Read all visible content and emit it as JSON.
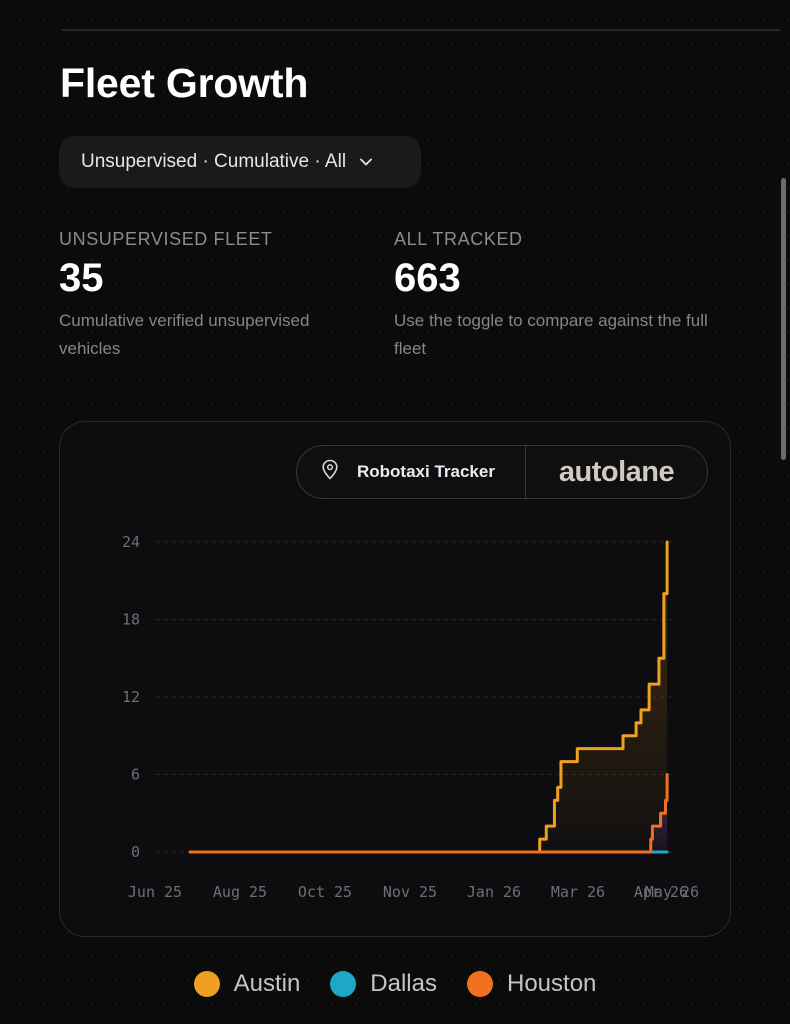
{
  "page": {
    "title": "Fleet Growth",
    "filter_label": "Unsupervised · Cumulative · All"
  },
  "stats": [
    {
      "label": "UNSUPERVISED FLEET",
      "value": "35",
      "description": "Cumulative verified unsupervised vehicles"
    },
    {
      "label": "ALL TRACKED",
      "value": "663",
      "description": "Use the toggle to compare against the full fleet"
    }
  ],
  "brand": {
    "tracker_label": "Robotaxi Tracker",
    "logo_text": "autolane",
    "icons": [
      "map-pin-icon"
    ]
  },
  "colors": {
    "austin": "#f0a020",
    "dallas": "#1ea8c8",
    "houston": "#f07020",
    "background": "#0b0b0c",
    "card": "#0d0d0f"
  },
  "chart_data": {
    "type": "line",
    "step": true,
    "cumulative": true,
    "x_ticks": [
      "Jun 25",
      "Aug 25",
      "Oct 25",
      "Nov 25",
      "Jan 26",
      "Mar 26",
      "Apr 26",
      "May 26"
    ],
    "y_ticks": [
      0,
      6,
      12,
      18,
      24
    ],
    "ylim": [
      0,
      24
    ],
    "grid": true,
    "legend_position": "bottom",
    "series": [
      {
        "name": "Austin",
        "color": "#f0a020",
        "points": [
          [
            "2025-06-22",
            0
          ],
          [
            "2026-01-22",
            1
          ],
          [
            "2026-01-26",
            2
          ],
          [
            "2026-01-31",
            4
          ],
          [
            "2026-02-02",
            5
          ],
          [
            "2026-02-04",
            7
          ],
          [
            "2026-02-14",
            8
          ],
          [
            "2026-03-14",
            9
          ],
          [
            "2026-03-22",
            10
          ],
          [
            "2026-03-25",
            11
          ],
          [
            "2026-03-30",
            13
          ],
          [
            "2026-04-05",
            15
          ],
          [
            "2026-04-08",
            20
          ],
          [
            "2026-04-10",
            24
          ]
        ]
      },
      {
        "name": "Dallas",
        "color": "#1ea8c8",
        "points": [
          [
            "2025-06-22",
            0
          ],
          [
            "2026-04-10",
            0
          ]
        ]
      },
      {
        "name": "Houston",
        "color": "#f07020",
        "points": [
          [
            "2025-06-22",
            0
          ],
          [
            "2026-03-31",
            1
          ],
          [
            "2026-04-01",
            2
          ],
          [
            "2026-04-06",
            3
          ],
          [
            "2026-04-09",
            4
          ],
          [
            "2026-04-10",
            6
          ]
        ]
      }
    ]
  }
}
